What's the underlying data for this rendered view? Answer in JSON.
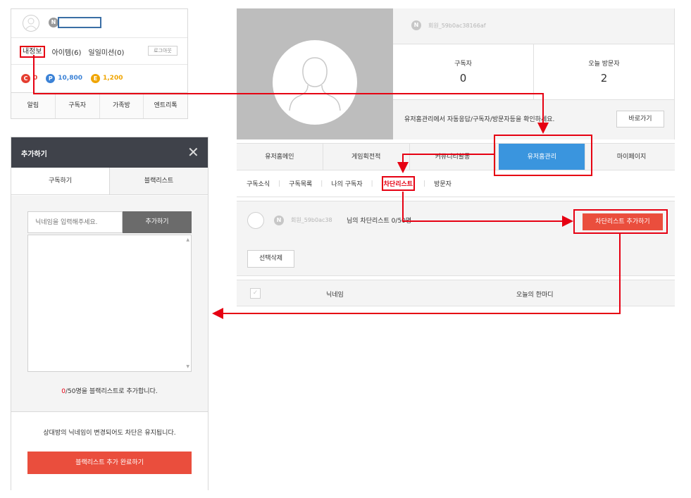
{
  "card": {
    "nick_badge": "N",
    "menu": {
      "my_info": "내정보",
      "items": "아이템(6)",
      "missions": "일일미션(0)",
      "logout": "로그아웃"
    },
    "coins": [
      {
        "icon": "C",
        "value": "0",
        "color": "#e53e30"
      },
      {
        "icon": "P",
        "value": "10,800",
        "color": "#3b82d6"
      },
      {
        "icon": "E",
        "value": "1,200",
        "color": "#f0a500"
      }
    ],
    "tabs": [
      "알림",
      "구독자",
      "가족방",
      "엔트리톡"
    ]
  },
  "home": {
    "nick_badge": "N",
    "nickname": "회원_59b0ac38166af",
    "stats": [
      {
        "label": "구독자",
        "value": "0"
      },
      {
        "label": "오늘 방문자",
        "value": "2"
      }
    ],
    "notice": "유저홈관리에서 자동응답/구독자/방문자등을 확인하세요.",
    "goto_button": "바로가기",
    "nav": [
      "유저홈메인",
      "게임획전적",
      "커뮤니티활동",
      "유저홈관리",
      "마이페이지"
    ],
    "sub": [
      "구독소식",
      "구독목록",
      "나의 구독자",
      "차단리스트",
      "방문자"
    ],
    "blocklist": {
      "nickname": "회원_59b0ac38",
      "title": "님의 차단리스트 0/50명",
      "add_button": "차단리스트 추가하기",
      "delete_button": "선택삭제"
    },
    "table_headers": {
      "nickname": "닉네임",
      "comment": "오늘의 한마디"
    }
  },
  "popup": {
    "title": "추가하기",
    "tabs": [
      "구독하기",
      "블랙리스트"
    ],
    "input_placeholder": "닉네임을 입력해주세요.",
    "add_button": "추가하기",
    "count_red": "0",
    "count_rest": "/50명을 블랙리스트로 추가합니다.",
    "notice": "상대방의 닉네임이 변경되어도 차단은 유지됩니다.",
    "done_button": "블랙리스트 추가 완료하기"
  },
  "colors": {
    "accent_red": "#e60012",
    "button_red": "#ea4e3d",
    "nav_active": "#3a95de",
    "popup_header": "#3f424a"
  }
}
